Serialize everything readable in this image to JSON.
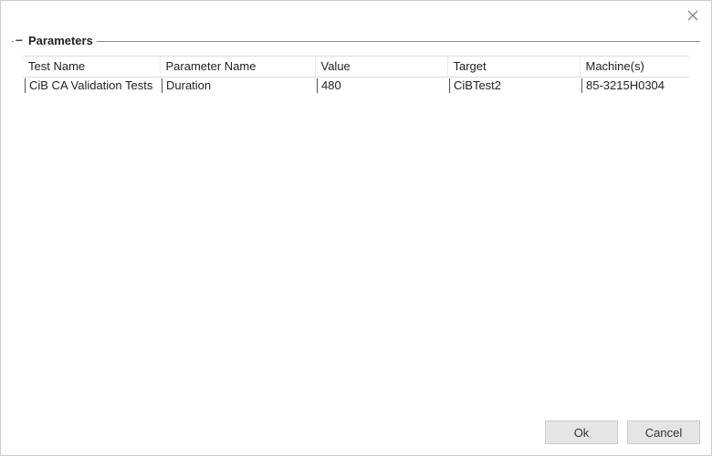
{
  "groupbox": {
    "title": "Parameters"
  },
  "table": {
    "headers": {
      "test_name": "Test Name",
      "parameter_name": "Parameter Name",
      "value": "Value",
      "target": "Target",
      "machines": "Machine(s)"
    },
    "rows": [
      {
        "test_name": "CiB CA Validation Tests",
        "parameter_name": "Duration",
        "value": "480",
        "target": "CiBTest2",
        "machines": "85-3215H0304"
      }
    ]
  },
  "buttons": {
    "ok": "Ok",
    "cancel": "Cancel"
  }
}
